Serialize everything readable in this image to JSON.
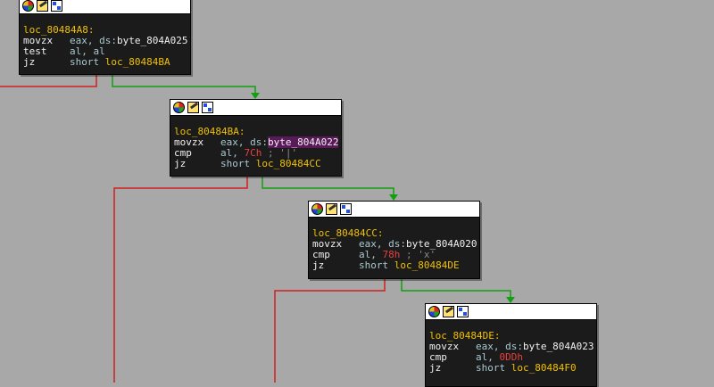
{
  "nodes": [
    {
      "label": "loc_80484A8:",
      "lines": [
        {
          "mn": "movzx",
          "op": "eax, ds:",
          "sym": "byte_804A025"
        },
        {
          "mn": "test",
          "op": "al, al"
        },
        {
          "mn": "jz",
          "op": "short ",
          "tgt": "loc_80484BA"
        }
      ]
    },
    {
      "label": "loc_80484BA:",
      "lines": [
        {
          "mn": "movzx",
          "op": "eax, ds:",
          "sym": "byte_804A022"
        },
        {
          "mn": "cmp",
          "op": "al, ",
          "num": "7Ch",
          "cmt": " ; '|'"
        },
        {
          "mn": "jz",
          "op": "short ",
          "tgt": "loc_80484CC"
        }
      ]
    },
    {
      "label": "loc_80484CC:",
      "lines": [
        {
          "mn": "movzx",
          "op": "eax, ds:",
          "sym": "byte_804A020"
        },
        {
          "mn": "cmp",
          "op": "al, ",
          "num": "78h",
          "cmt": " ; 'x'"
        },
        {
          "mn": "jz",
          "op": "short ",
          "tgt": "loc_80484DE"
        }
      ]
    },
    {
      "label": "loc_80484DE:",
      "lines": [
        {
          "mn": "movzx",
          "op": "eax, ds:",
          "sym": "byte_804A023"
        },
        {
          "mn": "cmp",
          "op": "al, ",
          "num": "0DDh"
        },
        {
          "mn": "jz",
          "op": "short ",
          "tgt": "loc_80484F0"
        }
      ]
    }
  ],
  "highlight_symbol": "byte_804A022",
  "colors": {
    "background": "#a8a8a8",
    "edge_true": "#10a010",
    "edge_false": "#d02020",
    "node_bg": "#1b1b1b",
    "label": "#f0c000",
    "number": "#e84040",
    "highlight": "#5a1a5a"
  },
  "header_icons": [
    "color-picker-icon",
    "rename-icon",
    "graph-view-icon"
  ]
}
